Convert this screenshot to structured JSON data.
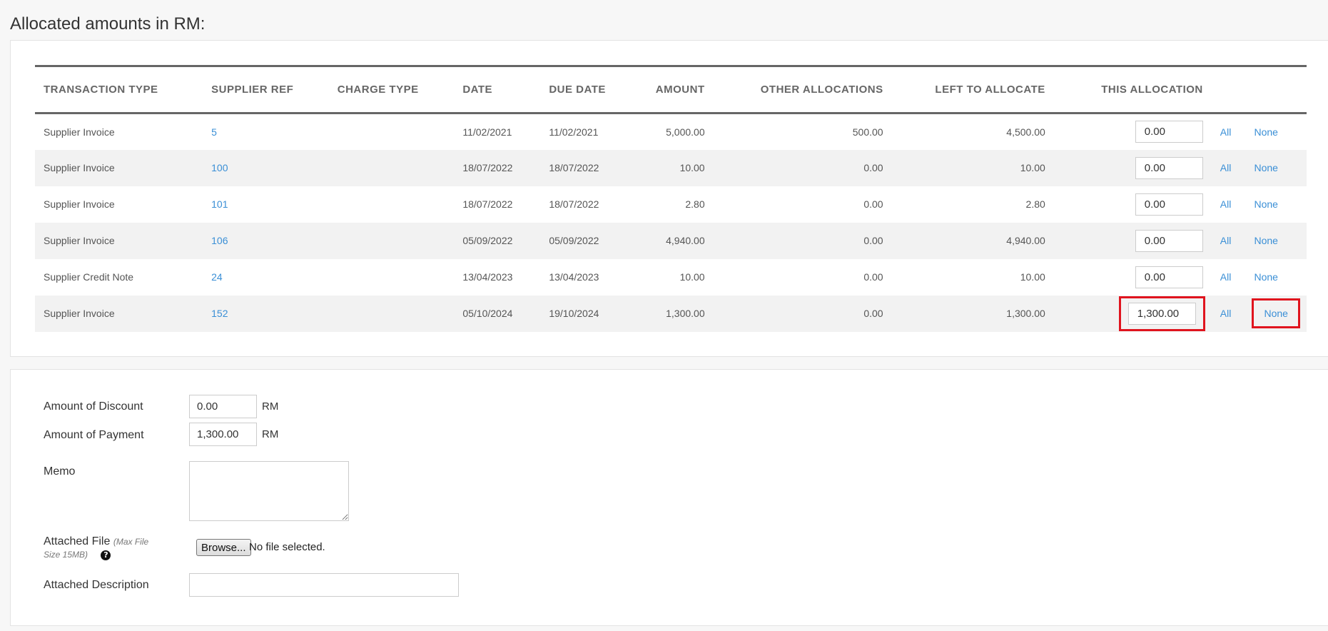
{
  "heading": "Allocated amounts in RM:",
  "table": {
    "columns": [
      "Transaction Type",
      "Supplier Ref",
      "Charge Type",
      "Date",
      "Due Date",
      "Amount",
      "Other Allocations",
      "Left to Allocate",
      "This Allocation"
    ],
    "rows": [
      {
        "type": "Supplier Invoice",
        "ref": "5",
        "charge": "",
        "date": "11/02/2021",
        "due": "11/02/2021",
        "amount": "5,000.00",
        "other": "500.00",
        "left": "4,500.00",
        "this": "0.00",
        "all": "All",
        "none": "None"
      },
      {
        "type": "Supplier Invoice",
        "ref": "100",
        "charge": "",
        "date": "18/07/2022",
        "due": "18/07/2022",
        "amount": "10.00",
        "other": "0.00",
        "left": "10.00",
        "this": "0.00",
        "all": "All",
        "none": "None"
      },
      {
        "type": "Supplier Invoice",
        "ref": "101",
        "charge": "",
        "date": "18/07/2022",
        "due": "18/07/2022",
        "amount": "2.80",
        "other": "0.00",
        "left": "2.80",
        "this": "0.00",
        "all": "All",
        "none": "None"
      },
      {
        "type": "Supplier Invoice",
        "ref": "106",
        "charge": "",
        "date": "05/09/2022",
        "due": "05/09/2022",
        "amount": "4,940.00",
        "other": "0.00",
        "left": "4,940.00",
        "this": "0.00",
        "all": "All",
        "none": "None"
      },
      {
        "type": "Supplier Credit Note",
        "ref": "24",
        "charge": "",
        "date": "13/04/2023",
        "due": "13/04/2023",
        "amount": "10.00",
        "other": "0.00",
        "left": "10.00",
        "this": "0.00",
        "all": "All",
        "none": "None"
      },
      {
        "type": "Supplier Invoice",
        "ref": "152",
        "charge": "",
        "date": "05/10/2024",
        "due": "19/10/2024",
        "amount": "1,300.00",
        "other": "0.00",
        "left": "1,300.00",
        "this": "1,300.00",
        "all": "All",
        "none": "None"
      }
    ]
  },
  "form": {
    "discount_label": "Amount of Discount",
    "discount_value": "0.00",
    "payment_label": "Amount of Payment",
    "payment_value": "1,300.00",
    "currency": "RM",
    "memo_label": "Memo",
    "memo_value": "",
    "file_label": "Attached File",
    "file_note": "(Max File Size 15MB)",
    "help_glyph": "?",
    "browse_label": "Browse...",
    "no_file_text": "No file selected.",
    "desc_label": "Attached Description",
    "desc_value": ""
  },
  "colors": {
    "link": "#3a8fd6",
    "highlight": "#e0141e"
  }
}
